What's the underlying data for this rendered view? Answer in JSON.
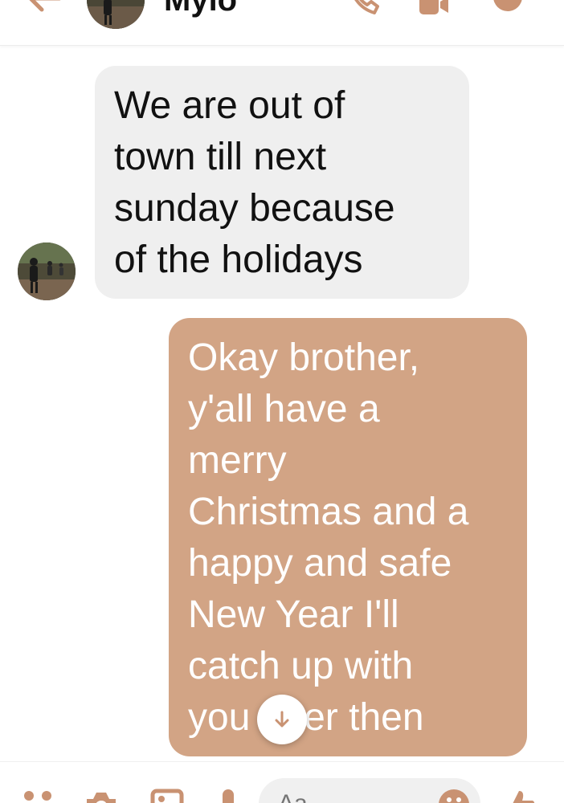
{
  "header": {
    "contact_name": "Mylo",
    "icons": {
      "back": "back-arrow-icon",
      "call": "phone-icon",
      "video": "video-camera-icon",
      "info": "info-icon"
    }
  },
  "conversation": {
    "messages": [
      {
        "direction": "incoming",
        "lines": [
          "We are out of",
          "town till next",
          "sunday because",
          "of the holidays"
        ]
      },
      {
        "direction": "outgoing",
        "lines": [
          "Okay brother,",
          "y'all have a",
          "merry",
          "Christmas and a",
          "happy and safe",
          "New Year I'll",
          "catch up with",
          "you after then"
        ]
      }
    ]
  },
  "composer": {
    "placeholder": "Aa",
    "icons": [
      "more-dots-icon",
      "camera-icon",
      "gallery-icon",
      "microphone-icon",
      "emoji-icon",
      "thumbs-up-icon"
    ]
  },
  "colors": {
    "incoming_bubble": "#efefef",
    "outgoing_bubble": "#d2a485",
    "accent": "#c99272"
  }
}
